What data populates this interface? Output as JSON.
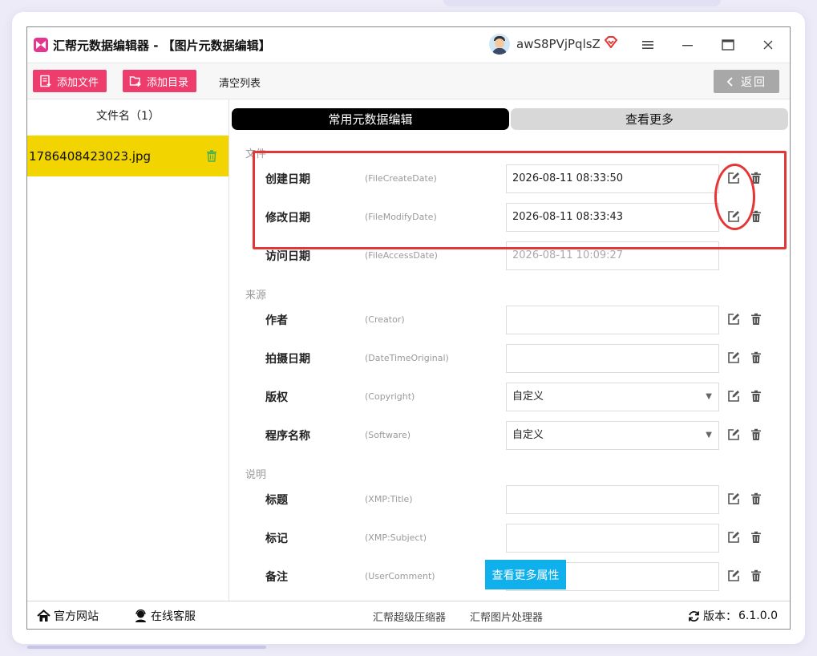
{
  "window": {
    "title": "汇帮元数据编辑器 - 【图片元数据编辑】",
    "username": "awS8PVjPqlsZ"
  },
  "toolbar": {
    "add_file": "添加文件",
    "add_folder": "添加目录",
    "clear_list": "清空列表",
    "back": "返回"
  },
  "file_list": {
    "header": "文件名（1）",
    "files": [
      "1786408423023.jpg"
    ]
  },
  "tabs": {
    "common": "常用元数据编辑",
    "more": "查看更多"
  },
  "sections": {
    "file": "文件",
    "source": "来源",
    "description": "说明"
  },
  "fields": [
    {
      "label": "创建日期",
      "key": "(FileCreateDate)",
      "value": "2026-08-11 08:33:50"
    },
    {
      "label": "修改日期",
      "key": "(FileModifyDate)",
      "value": "2026-08-11 08:33:43"
    },
    {
      "label": "访问日期",
      "key": "(FileAccessDate)",
      "value": "2026-08-11 10:09:27"
    },
    {
      "label": "作者",
      "key": "(Creator)",
      "value": ""
    },
    {
      "label": "拍摄日期",
      "key": "(DateTimeOriginal)",
      "value": ""
    },
    {
      "label": "版权",
      "key": "(Copyright)",
      "value": "自定义"
    },
    {
      "label": "程序名称",
      "key": "(Software)",
      "value": "自定义"
    },
    {
      "label": "标题",
      "key": "(XMP:Title)",
      "value": ""
    },
    {
      "label": "标记",
      "key": "(XMP:Subject)",
      "value": ""
    },
    {
      "label": "备注",
      "key": "(UserComment)",
      "value": ""
    }
  ],
  "more_attributes_button": "查看更多属性",
  "statusbar": {
    "website": "官方网站",
    "support": "在线客服",
    "compressor": "汇帮超级压缩器",
    "image_processor": "汇帮图片处理器",
    "version_label": "版本：",
    "version": "6.1.0.0"
  },
  "colors": {
    "pink": "#ee3c6c",
    "highlight_row": "#f2d400",
    "annotation_red": "#e53636",
    "info_blue": "#0fb0ec"
  }
}
